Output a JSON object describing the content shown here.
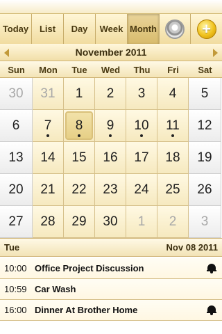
{
  "toolbar": {
    "tabs": [
      {
        "label": "Today"
      },
      {
        "label": "List"
      },
      {
        "label": "Day"
      },
      {
        "label": "Week"
      },
      {
        "label": "Month"
      }
    ],
    "selected_tab": "Month",
    "icons": [
      "gear-icon",
      "add-icon"
    ]
  },
  "month_header": {
    "title": "November 2011"
  },
  "weekdays": [
    "Sun",
    "Mon",
    "Tue",
    "Wed",
    "Thu",
    "Fri",
    "Sat"
  ],
  "calendar": {
    "weeks": [
      [
        {
          "d": "30",
          "dim": true
        },
        {
          "d": "31",
          "dim": true
        },
        {
          "d": "1"
        },
        {
          "d": "2"
        },
        {
          "d": "3"
        },
        {
          "d": "4"
        },
        {
          "d": "5"
        }
      ],
      [
        {
          "d": "6"
        },
        {
          "d": "7",
          "dot": true
        },
        {
          "d": "8",
          "dot": true,
          "selected": true
        },
        {
          "d": "9",
          "dot": true
        },
        {
          "d": "10",
          "dot": true
        },
        {
          "d": "11",
          "dot": true
        },
        {
          "d": "12"
        }
      ],
      [
        {
          "d": "13"
        },
        {
          "d": "14"
        },
        {
          "d": "15"
        },
        {
          "d": "16"
        },
        {
          "d": "17"
        },
        {
          "d": "18"
        },
        {
          "d": "19"
        }
      ],
      [
        {
          "d": "20"
        },
        {
          "d": "21"
        },
        {
          "d": "22"
        },
        {
          "d": "23"
        },
        {
          "d": "24"
        },
        {
          "d": "25"
        },
        {
          "d": "26"
        }
      ],
      [
        {
          "d": "27"
        },
        {
          "d": "28"
        },
        {
          "d": "29"
        },
        {
          "d": "30"
        },
        {
          "d": "1",
          "dim": true
        },
        {
          "d": "2",
          "dim": true
        },
        {
          "d": "3",
          "dim": true
        }
      ]
    ]
  },
  "agenda": {
    "day_label": "Tue",
    "date_label": "Nov 08 2011",
    "events": [
      {
        "time": "10:00",
        "title": "Office Project Discussion",
        "alarm": true
      },
      {
        "time": "10:59",
        "title": "Car Wash",
        "alarm": false
      },
      {
        "time": "16:00",
        "title": "Dinner At Brother Home",
        "alarm": true
      }
    ]
  },
  "colors": {
    "accent": "#c29a3a",
    "weekday_bg": "#f6e9bf",
    "weekend_bg": "#ececec"
  }
}
